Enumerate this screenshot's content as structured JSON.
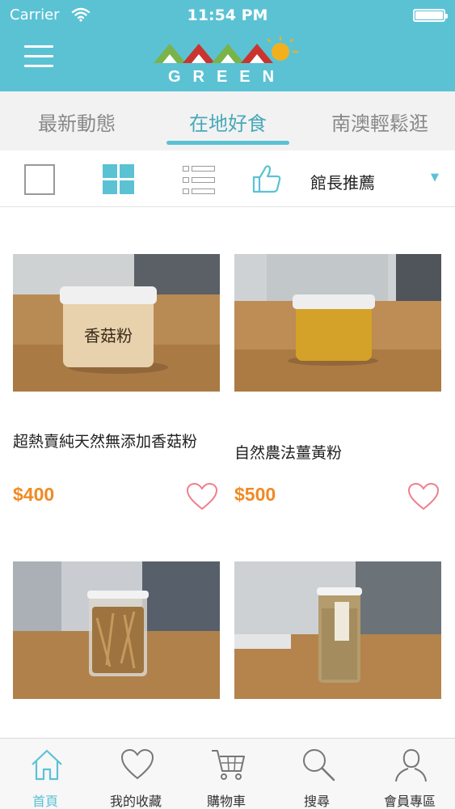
{
  "status_bar": {
    "carrier": "Carrier",
    "time": "11:54 PM"
  },
  "header": {
    "logo_text": "GREEN",
    "menu_icon": "hamburger-icon"
  },
  "tabs": [
    {
      "label": "最新動態",
      "active": false
    },
    {
      "label": "在地好食",
      "active": true
    },
    {
      "label": "南澳輕鬆逛",
      "active": false
    }
  ],
  "toolbar": {
    "view_modes": [
      "single-view-icon",
      "grid-view-icon",
      "list-view-icon"
    ],
    "active_view": "grid",
    "sort_icon": "thumbs-up-icon",
    "sort_label": "館長推薦"
  },
  "products": [
    {
      "name": "超熱賣純天然無添加香菇粉",
      "price": "$400",
      "photo_label": "香菇粉"
    },
    {
      "name": "自然農法薑黃粉",
      "price": "$500"
    },
    {
      "name": "",
      "price": ""
    },
    {
      "name": "",
      "price": ""
    }
  ],
  "tabbar": [
    {
      "label": "首頁",
      "icon": "home-icon",
      "active": true
    },
    {
      "label": "我的收藏",
      "icon": "heart-icon",
      "active": false
    },
    {
      "label": "購物車",
      "icon": "cart-icon",
      "active": false
    },
    {
      "label": "搜尋",
      "icon": "search-icon",
      "active": false
    },
    {
      "label": "會員專區",
      "icon": "user-icon",
      "active": false
    }
  ],
  "colors": {
    "brand": "#5bc2d4",
    "price": "#f08a24",
    "favorite": "#f07e8c"
  }
}
